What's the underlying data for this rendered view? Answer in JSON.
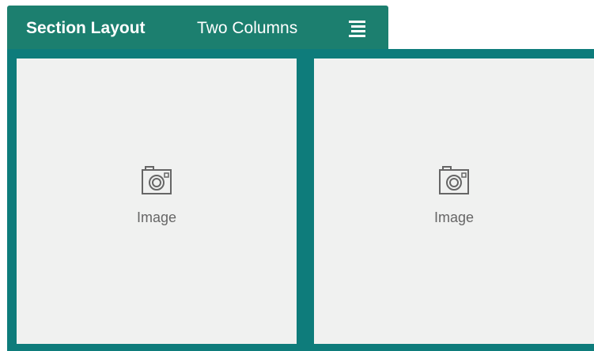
{
  "section": {
    "title": "Section Layout",
    "layout": "Two Columns",
    "menu_icon": "hamburger-menu-icon"
  },
  "columns": [
    {
      "placeholder_icon": "camera-icon",
      "placeholder_label": "Image"
    },
    {
      "placeholder_icon": "camera-icon",
      "placeholder_label": "Image"
    }
  ],
  "colors": {
    "tab_bg": "#1c7f6f",
    "frame_border": "#0e7c7b",
    "column_bg": "#f0f1f0",
    "icon_stroke": "#666666"
  }
}
